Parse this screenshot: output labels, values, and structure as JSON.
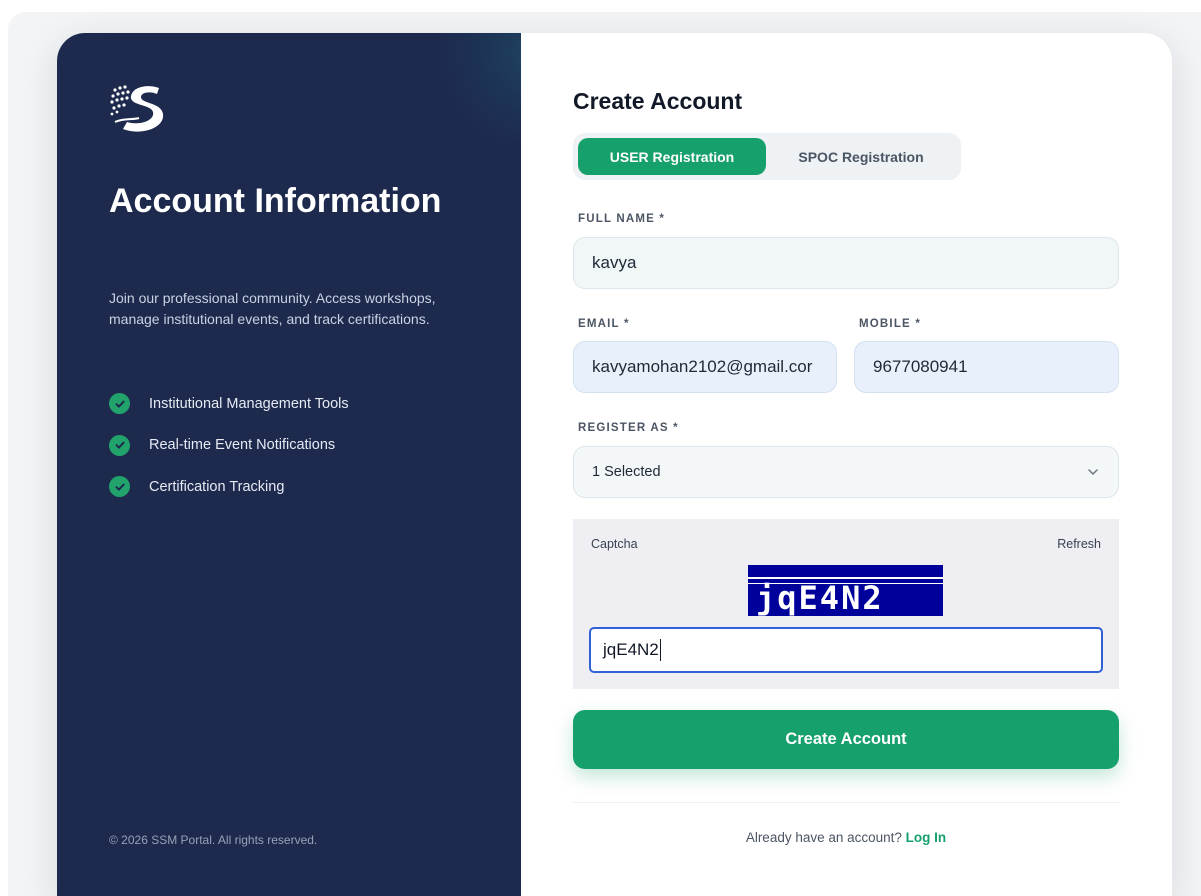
{
  "left_panel": {
    "title": "Account Information",
    "description": "Join our professional community. Access workshops, manage institutional events, and track certifications.",
    "features": [
      "Institutional Management Tools",
      "Real-time Event Notifications",
      "Certification Tracking"
    ],
    "copyright": "© 2026 SSM Portal. All rights reserved."
  },
  "form": {
    "title": "Create Account",
    "tabs": [
      "USER Registration",
      "SPOC Registration"
    ],
    "active_tab": "USER Registration",
    "full_name": {
      "label": "FULL NAME *",
      "value": "kavya"
    },
    "email": {
      "label": "EMAIL *",
      "value": "kavyamohan2102@gmail.cor"
    },
    "mobile": {
      "label": "MOBILE *",
      "value": "9677080941"
    },
    "register_as": {
      "label": "REGISTER AS *",
      "value": "1 Selected"
    },
    "captcha": {
      "label": "Captcha",
      "refresh_label": "Refresh",
      "image_text": "jqE4N2",
      "input_value": "jqE4N2"
    },
    "submit_label": "Create Account",
    "footer": {
      "prompt": "Already have an account? ",
      "login_label": "Log In"
    }
  },
  "colors": {
    "panel_navy": "#1d2a4d",
    "accent_green": "#16a06b",
    "captcha_blue": "#00009a",
    "focus_blue": "#2f62d6"
  }
}
